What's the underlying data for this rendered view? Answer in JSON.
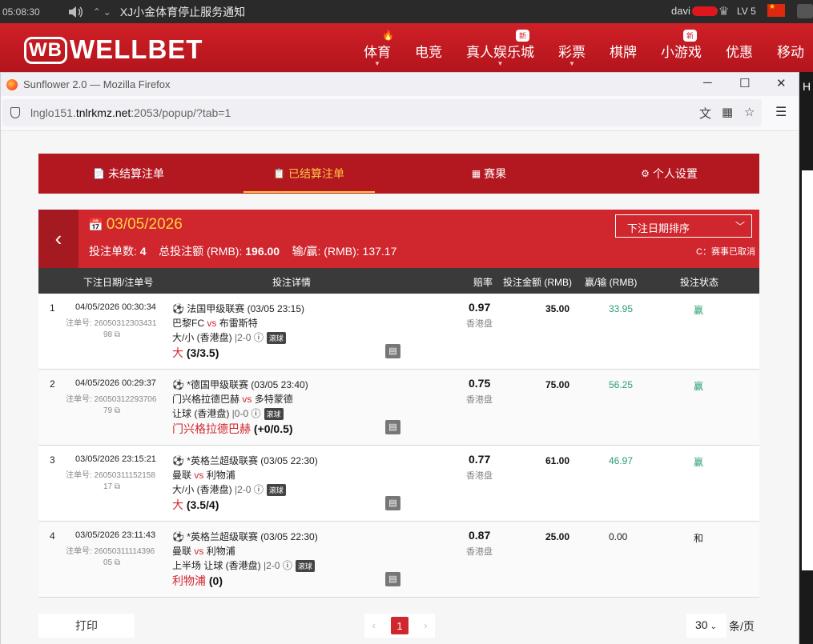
{
  "os_bar": {
    "time": "05:08:30",
    "notice": "XJ小金体育停止服务通知",
    "username": "davi",
    "level": "LV 5"
  },
  "site": {
    "logo_mark": "WB",
    "logo_text": "WELLBET",
    "nav": [
      {
        "label": "体育",
        "badge": "",
        "has_caret": true,
        "has_fire": true
      },
      {
        "label": "电竞",
        "badge": "",
        "has_caret": false,
        "has_fire": false
      },
      {
        "label": "真人娱乐城",
        "badge": "新",
        "has_caret": true,
        "has_fire": false
      },
      {
        "label": "彩票",
        "badge": "",
        "has_caret": true,
        "has_fire": false
      },
      {
        "label": "棋牌",
        "badge": "",
        "has_caret": false,
        "has_fire": false
      },
      {
        "label": "小游戏",
        "badge": "新",
        "has_caret": false,
        "has_fire": false
      },
      {
        "label": "优惠",
        "badge": "",
        "has_caret": false,
        "has_fire": false
      },
      {
        "label": "移动",
        "badge": "",
        "has_caret": false,
        "has_fire": false
      }
    ]
  },
  "browser": {
    "title": "Sunflower 2.0 — Mozilla Firefox",
    "url_prefix": "lnglo151.",
    "url_domain": "tnlrkmz.net",
    "url_suffix": ":2053/popup/?tab=1",
    "minimize": "─",
    "maximize": "☐",
    "close": "✕",
    "menu": "☰"
  },
  "tabs": [
    {
      "label": "未结算注单",
      "icon": "📄"
    },
    {
      "label": "已结算注单",
      "icon": "📋"
    },
    {
      "label": "赛果",
      "icon": "▦"
    },
    {
      "label": "个人设置",
      "icon": "⚙"
    }
  ],
  "summary": {
    "date": "03/05/2026",
    "count_label": "投注单数:",
    "count": "4",
    "total_label": "总投注额 (RMB):",
    "total": "196.00",
    "winloss_label": "输/赢: (RMB):",
    "winloss": "137.17",
    "sort_label": "下注日期排序",
    "cancel_note": "C：赛事已取消"
  },
  "table": {
    "headers": [
      "下注日期/注单号",
      "投注详情",
      "赔率",
      "投注金额 (RMB)",
      "赢/输 (RMB)",
      "投注状态"
    ],
    "rows": [
      {
        "n": "1",
        "datetime": "04/05/2026 00:30:34",
        "order_label": "注单号: 26050312303431",
        "order_suffix": "98",
        "league": "法国甲级联赛 (03/05 23:15)",
        "home": "巴黎FC",
        "vs": "vs",
        "away": "布雷斯特",
        "market": "大/小 (香港盘)",
        "score": "2-0",
        "live": "滚球",
        "pick": "大",
        "handicap": "(3/3.5)",
        "odds": "0.97",
        "odds_type": "香港盘",
        "stake": "35.00",
        "winloss": "33.95",
        "status": "赢",
        "result": "win"
      },
      {
        "n": "2",
        "datetime": "04/05/2026 00:29:37",
        "order_label": "注单号: 26050312293706",
        "order_suffix": "79",
        "league": "*德国甲级联赛 (03/05 23:40)",
        "home": "门兴格拉德巴赫",
        "vs": "vs",
        "away": "多特蒙德",
        "market": "让球 (香港盘)",
        "score": "0-0",
        "live": "滚球",
        "pick": "门兴格拉德巴赫",
        "handicap": "(+0/0.5)",
        "odds": "0.75",
        "odds_type": "香港盘",
        "stake": "75.00",
        "winloss": "56.25",
        "status": "赢",
        "result": "win"
      },
      {
        "n": "3",
        "datetime": "03/05/2026 23:15:21",
        "order_label": "注单号: 26050311152158",
        "order_suffix": "17",
        "league": "*英格兰超级联赛 (03/05 22:30)",
        "home": "曼联",
        "vs": "vs",
        "away": "利物浦",
        "market": "大/小 (香港盘)",
        "score": "2-0",
        "live": "滚球",
        "pick": "大",
        "handicap": "(3.5/4)",
        "odds": "0.77",
        "odds_type": "香港盘",
        "stake": "61.00",
        "winloss": "46.97",
        "status": "赢",
        "result": "win"
      },
      {
        "n": "4",
        "datetime": "03/05/2026 23:11:43",
        "order_label": "注单号: 26050311114396",
        "order_suffix": "05",
        "league": "*英格兰超级联赛 (03/05 22:30)",
        "home": "曼联",
        "vs": "vs",
        "away": "利物浦",
        "market": "上半场 让球 (香港盘)",
        "score": "2-0",
        "live": "滚球",
        "pick": "利物浦",
        "handicap": "(0)",
        "odds": "0.87",
        "odds_type": "香港盘",
        "stake": "25.00",
        "winloss": "0.00",
        "status": "和",
        "result": "draw"
      }
    ]
  },
  "footer": {
    "print_label": "打印",
    "prev": "‹",
    "page": "1",
    "next": "›",
    "per_page": "30",
    "per_page_label": "条/页"
  },
  "colors": {
    "brand_red": "#cf2027",
    "accent_gold": "#ffc543",
    "win_green": "#2aa06f"
  },
  "right_edge": {
    "letter": "H"
  }
}
